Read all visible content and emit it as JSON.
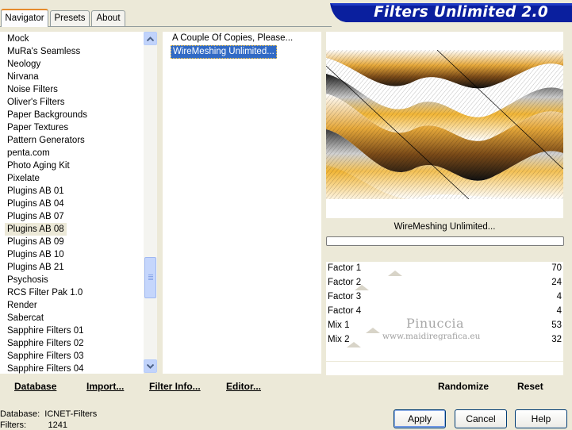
{
  "tabs": [
    "Navigator",
    "Presets",
    "About"
  ],
  "app_title": "Filters Unlimited 2.0",
  "categories": [
    "Mock",
    "MuRa's Seamless",
    "Neology",
    "Nirvana",
    "Noise Filters",
    "Oliver's Filters",
    "Paper Backgrounds",
    "Paper Textures",
    "Pattern Generators",
    "penta.com",
    "Photo Aging Kit",
    "Pixelate",
    "Plugins AB 01",
    "Plugins AB 04",
    "Plugins AB 07",
    "Plugins AB 08",
    "Plugins AB 09",
    "Plugins AB 10",
    "Plugins AB 21",
    "Psychosis",
    "RCS Filter Pak 1.0",
    "Render",
    "Sabercat",
    "Sapphire Filters 01",
    "Sapphire Filters 02",
    "Sapphire Filters 03",
    "Sapphire Filters 04"
  ],
  "selected_category": "Plugins AB 08",
  "filters": [
    "A Couple Of Copies, Please...",
    "WireMeshing Unlimited..."
  ],
  "selected_filter": "WireMeshing Unlimited...",
  "left_buttons": {
    "database": "Database",
    "import": "Import...",
    "filter_info": "Filter Info...",
    "editor": "Editor..."
  },
  "preview_caption": "WireMeshing Unlimited...",
  "progress": 0,
  "params": [
    {
      "label": "Factor 1",
      "value": "70"
    },
    {
      "label": "Factor 2",
      "value": "24"
    },
    {
      "label": "Factor 3",
      "value": "4"
    },
    {
      "label": "Factor 4",
      "value": "4"
    },
    {
      "label": "Mix 1",
      "value": "53"
    },
    {
      "label": "Mix 2",
      "value": "32"
    }
  ],
  "right_buttons": {
    "randomize": "Randomize",
    "reset": "Reset"
  },
  "watermark": {
    "name": "Pinuccia",
    "url": "www.maidiregrafica.eu"
  },
  "status": {
    "database_label": "Database:",
    "database_value": "ICNET-Filters",
    "filters_label": "Filters:",
    "filters_value": "1241"
  },
  "dialog_buttons": {
    "apply": "Apply",
    "cancel": "Cancel",
    "help": "Help"
  },
  "icons": {
    "scroll_up": "chevron-up-icon",
    "scroll_down": "chevron-down-icon"
  },
  "colors": {
    "selection": "#316ac5",
    "banner": "#0a1f9e",
    "tab_highlight": "#e68b2c"
  }
}
